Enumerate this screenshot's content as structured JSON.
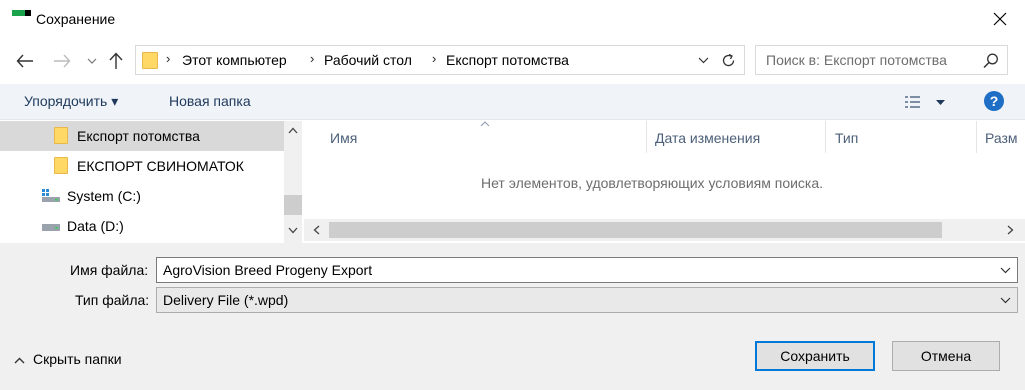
{
  "window": {
    "title": "Сохранение"
  },
  "address": {
    "crumbs": [
      "Этот компьютер",
      "Рабочий стол",
      "Експорт потомства"
    ]
  },
  "search": {
    "placeholder": "Поиск в: Експорт потомства"
  },
  "toolbar": {
    "organize_label": "Упорядочить ▾",
    "new_folder_label": "Новая папка",
    "help_label": "?"
  },
  "nav": {
    "items": [
      {
        "label": "Експорт потомства",
        "icon": "folder-icon",
        "selected": true
      },
      {
        "label": "ЕКСПОРТ СВИНОМАТОК",
        "icon": "folder-icon",
        "selected": false
      },
      {
        "label": "System (C:)",
        "icon": "windows-drive-icon",
        "selected": false
      },
      {
        "label": "Data (D:)",
        "icon": "drive-icon",
        "selected": false
      }
    ]
  },
  "filelist": {
    "columns": [
      "Имя",
      "Дата изменения",
      "Тип",
      "Разм"
    ],
    "empty_message": "Нет элементов, удовлетворяющих условиям поиска."
  },
  "form": {
    "filename_label": "Имя файла:",
    "filename_value": "AgroVision Breed Progeny Export",
    "filetype_label": "Тип файла:",
    "filetype_value": "Delivery File (*.wpd)"
  },
  "footer": {
    "hide_folders_label": "Скрыть папки",
    "save_label": "Сохранить",
    "cancel_label": "Отмена"
  },
  "colors": {
    "accent": "#0078d7",
    "help": "#1f6ec6",
    "toolbar_bg": "#f0f4f9",
    "panel_bg": "#f0f0f0"
  }
}
